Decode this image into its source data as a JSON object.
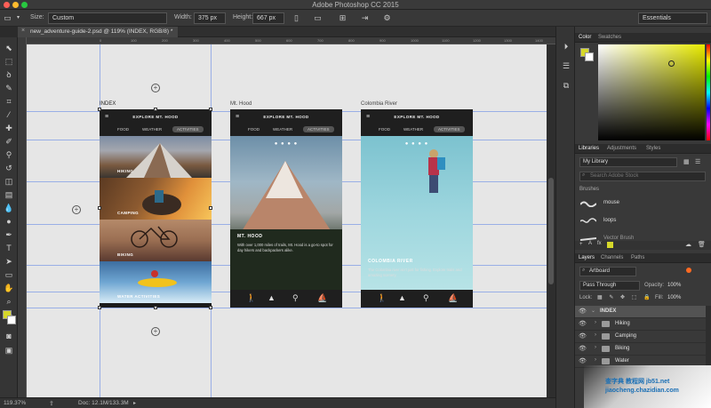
{
  "app": {
    "title": "Adobe Photoshop CC 2015"
  },
  "options_bar": {
    "size_label": "Size:",
    "size_value": "Custom",
    "width_label": "Width:",
    "width_value": "375 px",
    "height_label": "Height:",
    "height_value": "667 px",
    "workspace": "Essentials"
  },
  "document": {
    "tab_label": "new_adventure-guide-2.psd @ 119% (INDEX, RGB/8) *"
  },
  "ruler": {
    "ticks": [
      "0",
      "100",
      "200",
      "300",
      "400",
      "500",
      "600",
      "700",
      "800",
      "900",
      "1000",
      "1100",
      "1200",
      "1300",
      "1400",
      "1500",
      "1600"
    ]
  },
  "artboards": [
    {
      "label": "INDEX",
      "header_title": "EXPLORE MT. HOOD",
      "nav": [
        "FOOD",
        "WEATHER",
        "ACTIVITIES"
      ],
      "sections": [
        "HIKING",
        "CAMPING",
        "BIKING",
        "WATER ACTIVITIES"
      ]
    },
    {
      "label": "Mt. Hood",
      "header_title": "EXPLORE MT. HOOD",
      "nav": [
        "FOOD",
        "WEATHER",
        "ACTIVITIES"
      ],
      "dots": "● ● ● ●",
      "hero_title": "MT. HOOD",
      "hero_desc": "With over 1,000 miles of trails, Mt. Hood is a go-to spot for day hikers and backpackers alike."
    },
    {
      "label": "Colombia River",
      "header_title": "EXPLORE MT. HOOD",
      "nav": [
        "FOOD",
        "WEATHER",
        "ACTIVITIES"
      ],
      "dots": "● ● ● ●",
      "hero_title": "COLOMBIA RIVER",
      "hero_desc": "The Colombia river isn't just for fishing. Explore trails and amazing scenery."
    }
  ],
  "status": {
    "zoom": "119.37%",
    "doc": "Doc: 12.1M/133.3M"
  },
  "panels": {
    "color_tabs": [
      "Color",
      "Swatches"
    ],
    "library_tabs": [
      "Libraries",
      "Adjustments",
      "Styles"
    ],
    "library_select": "My Library",
    "search_placeholder": "Search Adobe Stock",
    "brushes_heading": "Brushes",
    "brushes": [
      "mouse",
      "loops",
      "Vector Brush"
    ],
    "layer_tabs": [
      "Layers",
      "Channels",
      "Paths"
    ],
    "layer_filter": "Artboard",
    "blend_mode": "Pass Through",
    "opacity_label": "Opacity:",
    "opacity_value": "100%",
    "lock_label": "Lock:",
    "fill_label": "Fill:",
    "fill_value": "100%",
    "layers": [
      "INDEX",
      "Hiking",
      "Camping",
      "Biking",
      "Water"
    ]
  },
  "colors": {
    "foreground": "#d6d82a",
    "background": "#ffffff",
    "accent_orange": "#ff6a22",
    "selection": "#535353"
  },
  "watermark": {
    "text": "查字典 教程网 jb51.net jiaocheng.chazidian.com"
  }
}
